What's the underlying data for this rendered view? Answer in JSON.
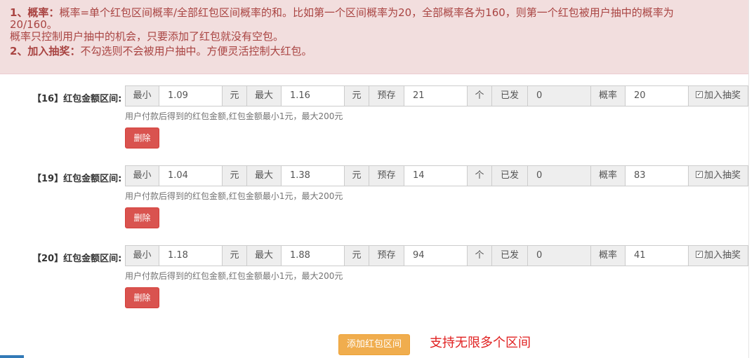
{
  "notice": {
    "item1_title": "1、概率：",
    "item1_text_a": "概率=单个红包区间概率/全部红包区间概率的和。比如第一个区间概率为20，全部概率各为160，则第一个红包被用户抽中的概率为",
    "item1_text_b": "20/160。",
    "item1_text_c": "概率只控制用户抽中的机会，只要添加了红包就没有空包。",
    "item2_title": "2、加入抽奖：",
    "item2_text": "不勾选则不会被用户抽中。方便灵活控制大红包。"
  },
  "labels": {
    "min": "最小",
    "yuan": "元",
    "max": "最大",
    "stock": "预存",
    "unit": "个",
    "sent": "已发",
    "prob": "概率",
    "join": "加入抽奖",
    "help": "用户付款后得到的红包金额,红包金额最小1元，最大200元",
    "delete": "删除"
  },
  "ranges": [
    {
      "label": "【16】红包金额区间:",
      "min": "1.09",
      "max": "1.16",
      "stock": "21",
      "sent": "0",
      "prob": "20",
      "checked": true
    },
    {
      "label": "【19】红包金额区间:",
      "min": "1.04",
      "max": "1.38",
      "stock": "14",
      "sent": "0",
      "prob": "83",
      "checked": true
    },
    {
      "label": "【20】红包金额区间:",
      "min": "1.18",
      "max": "1.88",
      "stock": "94",
      "sent": "0",
      "prob": "41",
      "checked": true
    }
  ],
  "footer": {
    "add_button": "添加红包区间",
    "note": "支持无限多个区间"
  }
}
